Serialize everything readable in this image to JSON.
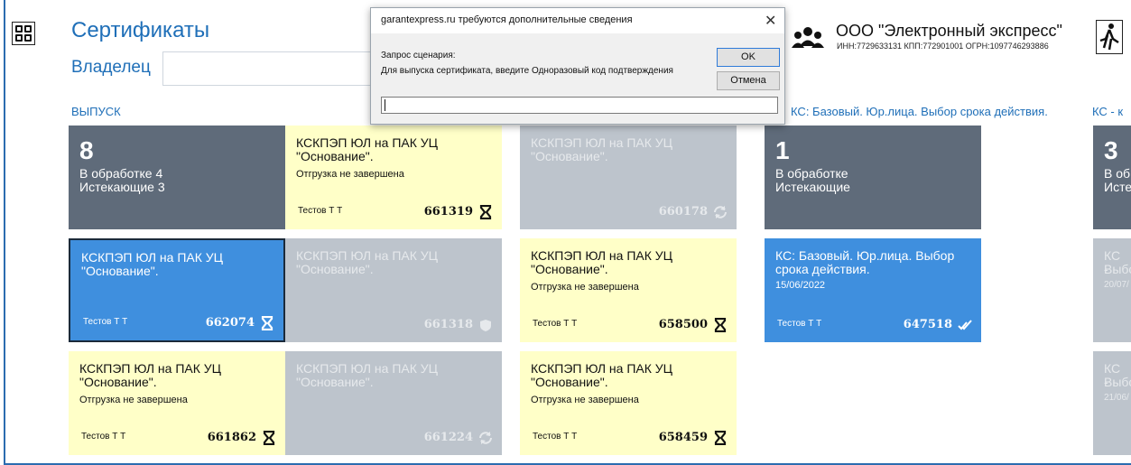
{
  "header": {
    "title": "Сертификаты",
    "owner_label": "Владелец",
    "owner_value": "",
    "org_name": "ООО \"Электронный экспресс\"",
    "org_details": "ИНН:7729633131 КПП:772901001 ОГРН:1097746293886"
  },
  "sections": {
    "issue": "ВЫПУСК",
    "hidden_issue": "",
    "ks_basic": "КС: Базовый. Юр.лица. Выбор срока действия.",
    "ks_right": "КС - к"
  },
  "tiles": {
    "summary_issue": {
      "count": "8",
      "line1": "В обработке 4",
      "line2": "Истекающие 3"
    },
    "t661319": {
      "title": "КСКПЭП ЮЛ на ПАК УЦ \"Основание\".",
      "status": "Отгрузка не завершена",
      "owner": "Тестов Т Т",
      "number": "661319",
      "icon": "hourglass-icon"
    },
    "t660178": {
      "title": "КСКПЭП ЮЛ на ПАК УЦ \"Основание\".",
      "number": "660178",
      "icon": "sync-icon"
    },
    "summary_ks": {
      "count": "1",
      "line1": "В обработке",
      "line2": "Истекающие"
    },
    "summary_ks2": {
      "count": "3",
      "line1": "В об",
      "line2": "Исте"
    },
    "t662074": {
      "title": "КСКПЭП ЮЛ на ПАК УЦ \"Основание\".",
      "owner": "Тестов Т Т",
      "number": "662074",
      "icon": "hourglass-icon"
    },
    "t661318": {
      "title": "КСКПЭП ЮЛ на ПАК УЦ \"Основание\".",
      "number": "661318",
      "icon": "shield-icon"
    },
    "t658500": {
      "title": "КСКПЭП ЮЛ на ПАК УЦ \"Основание\".",
      "status": "Отгрузка не завершена",
      "owner": "Тестов Т Т",
      "number": "658500",
      "icon": "hourglass-icon"
    },
    "t647518": {
      "title": "КС: Базовый. Юр.лица. Выбор срока действия.",
      "date": "15/06/2022",
      "owner": "Тестов Т Т",
      "number": "647518",
      "icon": "double-check-icon"
    },
    "tright1": {
      "title": "КС -",
      "title2": "Выбо",
      "date": "20/07/"
    },
    "t661862": {
      "title": "КСКПЭП ЮЛ на ПАК УЦ \"Основание\".",
      "status": "Отгрузка не завершена",
      "owner": "Тестов Т Т",
      "number": "661862",
      "icon": "hourglass-icon"
    },
    "t661224": {
      "title": "КСКПЭП ЮЛ на ПАК УЦ \"Основание\".",
      "number": "661224",
      "icon": "sync-icon"
    },
    "t658459": {
      "title": "КСКПЭП ЮЛ на ПАК УЦ \"Основание\".",
      "status": "Отгрузка не завершена",
      "owner": "Тестов Т Т",
      "number": "658459",
      "icon": "hourglass-icon"
    },
    "tright2": {
      "title": "КС -",
      "title2": "Выбо",
      "date": "21/06/"
    }
  },
  "dialog": {
    "title": "garantexpress.ru требуются дополнительные сведения",
    "label": "Запрос сценария:",
    "message": "Для выпуска сертификата, введите Одноразовый код подтверждения",
    "ok": "OK",
    "cancel": "Отмена",
    "input_value": ""
  },
  "colors": {
    "accent": "#1f6fb8",
    "tile_yellow": "#ffffc8",
    "tile_gray": "#bdc4cc",
    "tile_blue": "#3f8fde",
    "tile_dark": "#5f6b7a"
  }
}
